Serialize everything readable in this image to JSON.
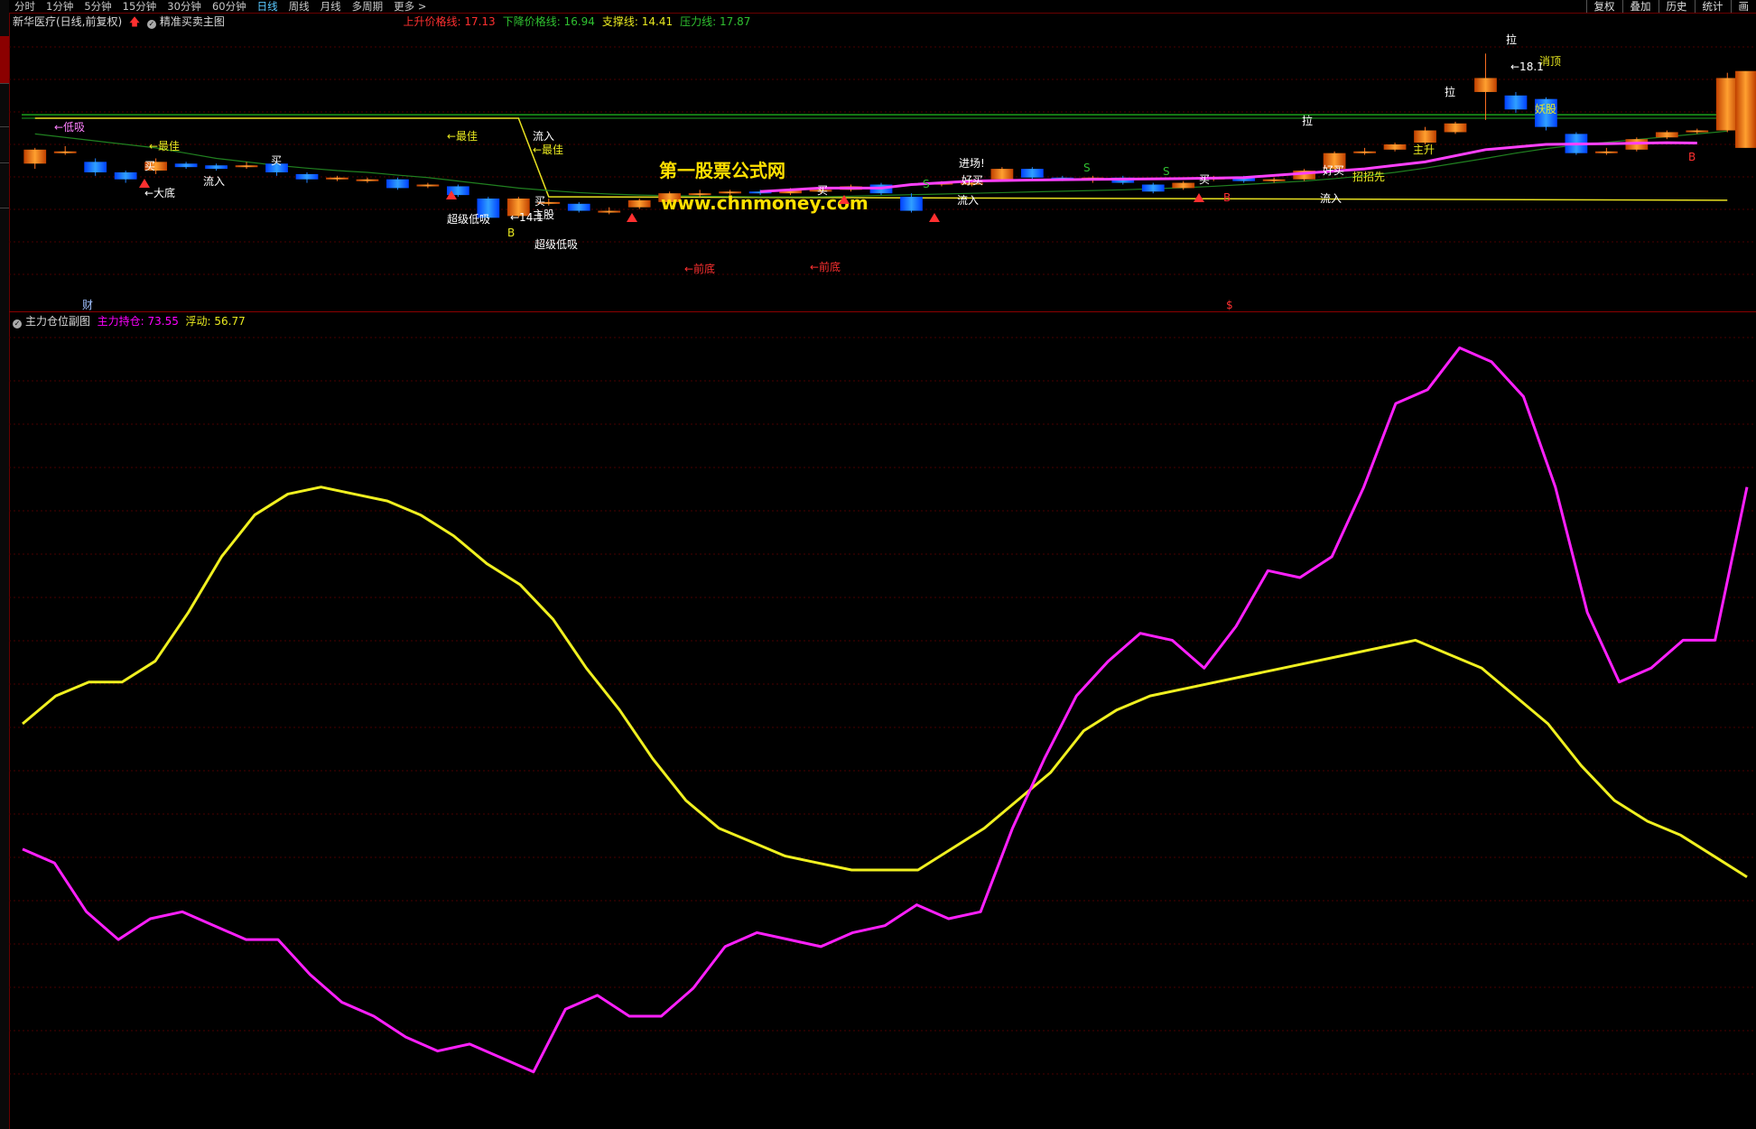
{
  "periods": [
    {
      "label": "分时"
    },
    {
      "label": "1分钟"
    },
    {
      "label": "5分钟"
    },
    {
      "label": "15分钟"
    },
    {
      "label": "30分钟"
    },
    {
      "label": "60分钟"
    },
    {
      "label": "日线",
      "active": true
    },
    {
      "label": "周线"
    },
    {
      "label": "月线"
    },
    {
      "label": "多周期"
    },
    {
      "label": "更多 >"
    }
  ],
  "right_buttons": [
    "复权",
    "叠加",
    "历史",
    "统计",
    "画"
  ],
  "main_panel": {
    "stock_name": "新华医疗(日线,前复权)",
    "indicator_name": "精准买卖主图",
    "lines": [
      {
        "label": "上升价格线:",
        "value": "17.13",
        "color": "#ff3030"
      },
      {
        "label": "下降价格线:",
        "value": "16.94",
        "color": "#30c030"
      },
      {
        "label": "支撑线:",
        "value": "14.41",
        "color": "#e8e820"
      },
      {
        "label": "压力线:",
        "value": "17.87",
        "color": "#30c030"
      }
    ],
    "watermark_title": "第一股票公式网",
    "watermark_url": "www.chnmoney.com"
  },
  "sub_panel": {
    "indicator_name": "主力仓位副图",
    "series_main_label": "主力持仓:",
    "series_main_value": "73.55",
    "series_float_label": "浮动:",
    "series_float_value": "56.77"
  },
  "annotations": [
    {
      "text": "←最佳",
      "color": "#e8e820"
    },
    {
      "text": "←最佳",
      "color": "#e8e820"
    },
    {
      "text": "←最佳",
      "color": "#e8e820"
    },
    {
      "text": "←低吸",
      "color": "#ff80ff"
    },
    {
      "text": "←大底",
      "color": "#ffffff"
    },
    {
      "text": "买",
      "color": "#ffffff"
    },
    {
      "text": "买",
      "color": "#ffffff"
    },
    {
      "text": "买",
      "color": "#ffffff"
    },
    {
      "text": "买",
      "color": "#ffffff"
    },
    {
      "text": "买",
      "color": "#ffffff"
    },
    {
      "text": "流入",
      "color": "#ffffff"
    },
    {
      "text": "流入",
      "color": "#ffffff"
    },
    {
      "text": "流入",
      "color": "#ffffff"
    },
    {
      "text": "流入",
      "color": "#ffffff"
    },
    {
      "text": "超级低吸",
      "color": "#ffffff"
    },
    {
      "text": "超级低吸",
      "color": "#ffffff"
    },
    {
      "text": "主股",
      "color": "#ffffff"
    },
    {
      "text": "B",
      "color": "#e8e820"
    },
    {
      "text": "B",
      "color": "#ff3030"
    },
    {
      "text": "B",
      "color": "#ff3030"
    },
    {
      "text": "S",
      "color": "#30c030"
    },
    {
      "text": "S",
      "color": "#30c030"
    },
    {
      "text": "S",
      "color": "#30c030"
    },
    {
      "text": "←前底",
      "color": "#ff3030"
    },
    {
      "text": "←前底",
      "color": "#ff3030"
    },
    {
      "text": "进场!",
      "color": "#ffffff"
    },
    {
      "text": "好买",
      "color": "#ffffff"
    },
    {
      "text": "好买",
      "color": "#ffffff"
    },
    {
      "text": "拉",
      "color": "#ffffff"
    },
    {
      "text": "拉",
      "color": "#ffffff"
    },
    {
      "text": "拉",
      "color": "#ffffff"
    },
    {
      "text": "主升",
      "color": "#e8e820"
    },
    {
      "text": "招招先",
      "color": "#e8e820"
    },
    {
      "text": "妖股",
      "color": "#e8e820"
    },
    {
      "text": "消顶",
      "color": "#e8e820"
    },
    {
      "text": "←14.1",
      "color": "#ffffff"
    },
    {
      "text": "←18.1",
      "color": "#ffffff"
    },
    {
      "text": "财",
      "color": "#a0c0ff"
    },
    {
      "text": "$",
      "color": "#ff3030"
    }
  ],
  "chart_data": {
    "type": "line",
    "candles": [
      [
        14.55,
        14.95,
        14.4,
        15.0
      ],
      [
        14.9,
        14.9,
        14.8,
        15.05
      ],
      [
        14.6,
        14.3,
        14.2,
        14.7
      ],
      [
        14.3,
        14.1,
        14.0,
        14.35
      ],
      [
        14.35,
        14.6,
        14.25,
        14.7
      ],
      [
        14.55,
        14.45,
        14.4,
        14.6
      ],
      [
        14.5,
        14.4,
        14.35,
        14.55
      ],
      [
        14.45,
        14.5,
        14.4,
        14.6
      ],
      [
        14.55,
        14.3,
        14.2,
        14.6
      ],
      [
        14.25,
        14.1,
        14.0,
        14.3
      ],
      [
        14.15,
        14.15,
        14.05,
        14.2
      ],
      [
        14.1,
        14.1,
        14.0,
        14.15
      ],
      [
        14.1,
        13.85,
        13.8,
        14.15
      ],
      [
        13.9,
        13.95,
        13.85,
        14.0
      ],
      [
        13.9,
        13.65,
        13.6,
        13.95
      ],
      [
        13.55,
        13.0,
        12.95,
        13.6
      ],
      [
        13.05,
        13.55,
        13.0,
        13.6
      ],
      [
        13.45,
        13.45,
        13.35,
        13.55
      ],
      [
        13.4,
        13.2,
        13.15,
        13.45
      ],
      [
        13.2,
        13.2,
        13.1,
        13.3
      ],
      [
        13.3,
        13.5,
        13.25,
        13.55
      ],
      [
        13.45,
        13.7,
        13.4,
        13.75
      ],
      [
        13.7,
        13.7,
        13.6,
        13.8
      ],
      [
        13.7,
        13.75,
        13.65,
        13.8
      ],
      [
        13.75,
        13.7,
        13.65,
        13.8
      ],
      [
        13.7,
        13.8,
        13.65,
        13.85
      ],
      [
        13.75,
        13.8,
        13.7,
        13.85
      ],
      [
        13.8,
        13.9,
        13.75,
        13.95
      ],
      [
        13.95,
        13.7,
        13.65,
        14.0
      ],
      [
        13.6,
        13.2,
        13.15,
        13.7
      ],
      [
        13.95,
        14.0,
        13.9,
        14.05
      ],
      [
        14.0,
        14.0,
        13.9,
        14.1
      ],
      [
        14.1,
        14.4,
        14.05,
        14.45
      ],
      [
        14.4,
        14.15,
        14.1,
        14.45
      ],
      [
        14.15,
        14.1,
        14.05,
        14.2
      ],
      [
        14.1,
        14.15,
        14.0,
        14.2
      ],
      [
        14.15,
        14.0,
        13.95,
        14.2
      ],
      [
        13.95,
        13.75,
        13.7,
        14.0
      ],
      [
        13.85,
        14.0,
        13.8,
        14.05
      ],
      [
        14.1,
        14.15,
        14.05,
        14.2
      ],
      [
        14.15,
        14.05,
        14.0,
        14.2
      ],
      [
        14.05,
        14.1,
        14.0,
        14.15
      ],
      [
        14.1,
        14.35,
        14.05,
        14.4
      ],
      [
        14.4,
        14.85,
        14.35,
        14.9
      ],
      [
        14.9,
        14.9,
        14.8,
        15.0
      ],
      [
        14.95,
        15.1,
        14.9,
        15.15
      ],
      [
        15.15,
        15.5,
        15.1,
        15.6
      ],
      [
        15.45,
        15.7,
        15.4,
        15.75
      ],
      [
        16.6,
        17.0,
        15.8,
        17.7
      ],
      [
        16.5,
        16.1,
        16.0,
        16.6
      ],
      [
        16.4,
        15.6,
        15.5,
        16.45
      ],
      [
        15.4,
        14.85,
        14.8,
        15.45
      ],
      [
        14.9,
        14.9,
        14.8,
        15.0
      ],
      [
        14.95,
        15.25,
        14.9,
        15.3
      ],
      [
        15.3,
        15.45,
        15.25,
        15.5
      ],
      [
        15.45,
        15.5,
        15.4,
        15.55
      ],
      [
        15.5,
        17.0,
        15.45,
        17.15
      ]
    ],
    "ma_green": [
      15.4,
      15.3,
      15.2,
      15.1,
      15.0,
      14.85,
      14.7,
      14.6,
      14.5,
      14.42,
      14.35,
      14.3,
      14.22,
      14.15,
      14.05,
      13.95,
      13.85,
      13.78,
      13.72,
      13.68,
      13.65,
      13.63,
      13.62,
      13.61,
      13.6,
      13.6,
      13.6,
      13.62,
      13.64,
      13.66,
      13.68,
      13.7,
      13.72,
      13.74,
      13.76,
      13.78,
      13.8,
      13.83,
      13.86,
      13.9,
      13.95,
      14.0,
      14.05,
      14.12,
      14.2,
      14.3,
      14.42,
      14.56,
      14.7,
      14.85,
      14.98,
      15.08,
      15.16,
      15.24,
      15.32,
      15.4,
      15.48
    ],
    "resist_line_green": 15.95,
    "resist_line_green2": 15.85,
    "yellow_segment": [
      [
        0,
        15.85
      ],
      [
        16,
        15.85
      ],
      [
        17,
        13.6
      ],
      [
        56,
        13.5
      ]
    ],
    "magenta_line": [
      [
        24,
        13.75
      ],
      [
        26,
        13.85
      ],
      [
        28,
        13.85
      ],
      [
        29,
        13.95
      ],
      [
        31,
        14.05
      ],
      [
        33,
        14.08
      ],
      [
        35,
        14.1
      ],
      [
        38,
        14.12
      ],
      [
        40,
        14.15
      ],
      [
        44,
        14.4
      ],
      [
        46,
        14.6
      ],
      [
        48,
        14.95
      ],
      [
        50,
        15.1
      ],
      [
        52,
        15.12
      ],
      [
        54,
        15.15
      ],
      [
        55,
        15.14
      ]
    ],
    "sub_yellow": [
      56,
      60,
      62,
      62,
      65,
      72,
      80,
      86,
      89,
      90,
      89,
      88,
      86,
      83,
      79,
      76,
      71,
      64,
      58,
      51,
      45,
      41,
      39,
      37,
      36,
      35,
      35,
      35,
      38,
      41,
      45,
      49,
      55,
      58,
      60,
      61,
      62,
      63,
      64,
      65,
      66,
      67,
      68,
      66,
      64,
      60,
      56,
      50,
      45,
      42,
      40,
      37,
      34
    ],
    "sub_magenta": [
      38,
      36,
      29,
      25,
      28,
      29,
      27,
      25,
      25,
      20,
      16,
      14,
      11,
      9,
      10,
      8,
      6,
      15,
      17,
      14,
      14,
      18,
      24,
      26,
      25,
      24,
      26,
      27,
      30,
      28,
      29,
      41,
      51,
      60,
      65,
      69,
      68,
      64,
      70,
      78,
      77,
      80,
      90,
      102,
      104,
      110,
      108,
      103,
      90,
      72,
      62,
      64,
      68,
      68,
      90
    ]
  }
}
